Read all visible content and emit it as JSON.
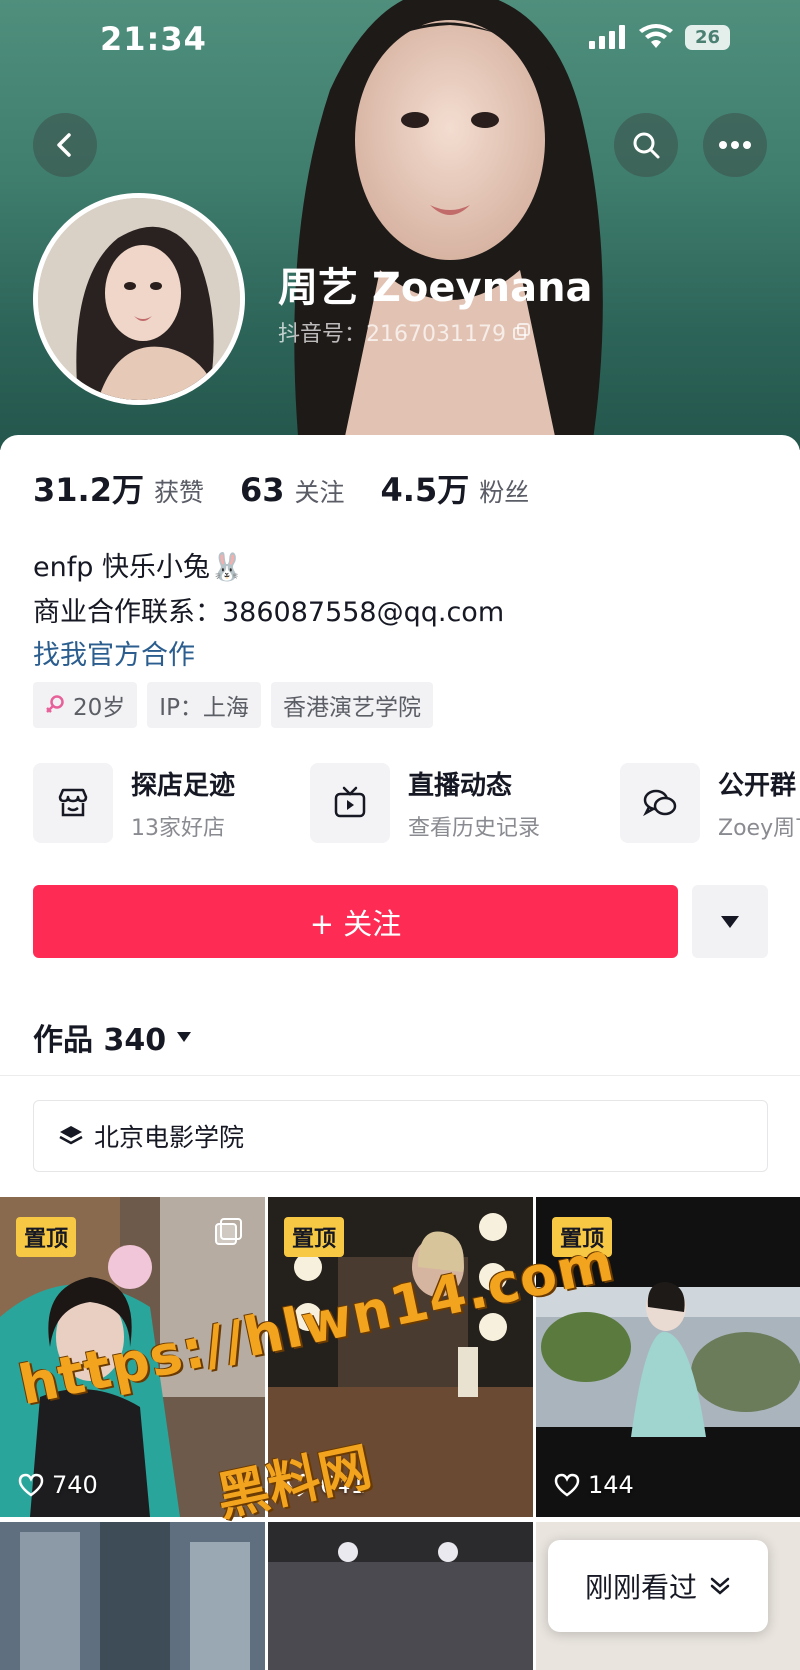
{
  "status_bar": {
    "time": "21:34",
    "battery": "26"
  },
  "profile": {
    "name": "周艺 Zoeynana",
    "douyin_id": "抖音号：2167031179"
  },
  "stats": [
    {
      "value": "31.2万",
      "label": "获赞"
    },
    {
      "value": "63",
      "label": "关注"
    },
    {
      "value": "4.5万",
      "label": "粉丝"
    }
  ],
  "bio": {
    "line1": "enfp 快乐小兔🐰",
    "line2": "商业合作联系：386087558@qq.com",
    "link": "找我官方合作"
  },
  "tags": [
    "20岁",
    "IP：上海",
    "香港演艺学院"
  ],
  "features": [
    {
      "title": "探店足迹",
      "subtitle": "13家好店",
      "icon": "shop-icon"
    },
    {
      "title": "直播动态",
      "subtitle": "查看历史记录",
      "icon": "tv-icon"
    },
    {
      "title": "公开群",
      "subtitle": "Zoey周丁",
      "icon": "chat-bubbles-icon"
    }
  ],
  "follow_button": "+ 关注",
  "works_tab": {
    "label": "作品 340"
  },
  "collection": {
    "label": "北京电影学院"
  },
  "videos": [
    {
      "badge": "置顶",
      "likes": "740"
    },
    {
      "badge": "置顶",
      "likes": "641"
    },
    {
      "badge": "置顶",
      "likes": "144"
    }
  ],
  "watermark": {
    "url": "https://hlwn14.com",
    "name": "黑料网"
  },
  "recent_pill": "刚刚看过",
  "colors": {
    "accent": "#fe2c55",
    "link": "#2b5e8f",
    "badge": "#f7c844",
    "header_bg": "#3f7d6d"
  }
}
